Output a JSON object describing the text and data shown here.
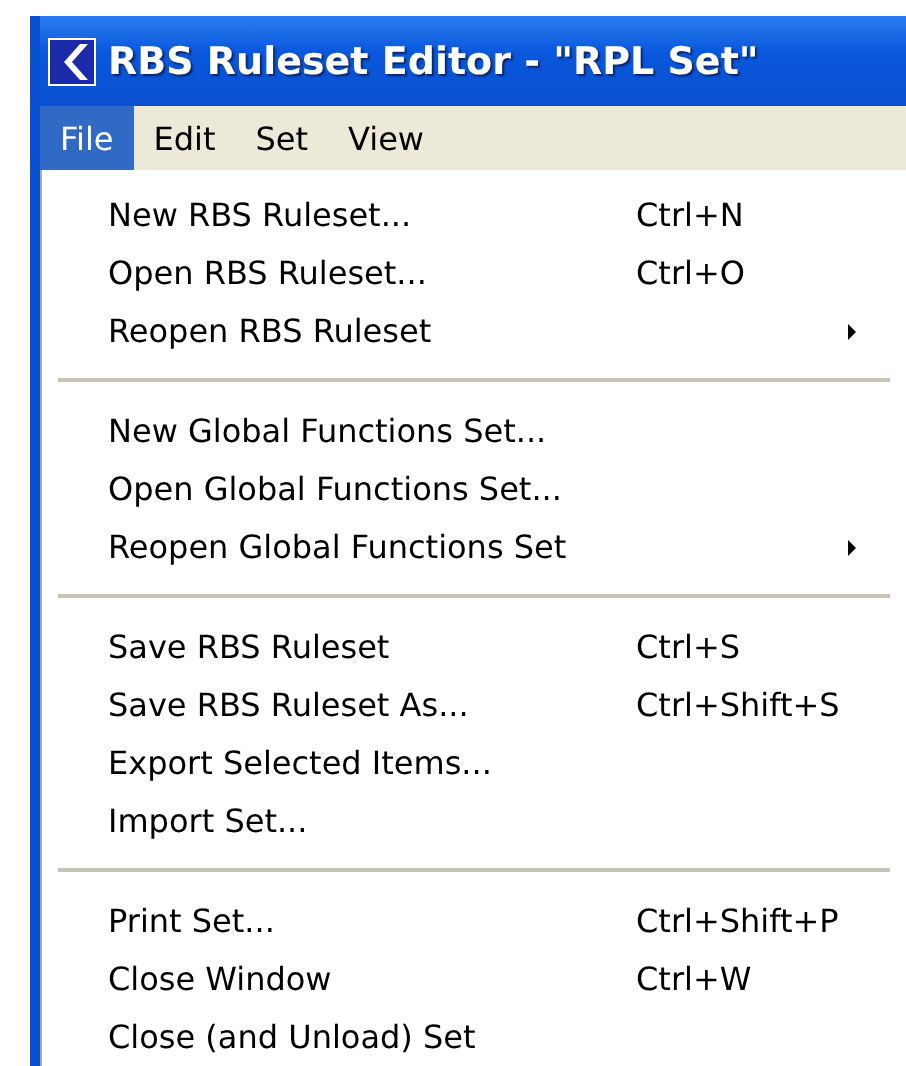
{
  "window": {
    "title": "RBS Ruleset Editor - \"RPL Set\""
  },
  "menu_bar": [
    {
      "label": "File",
      "selected": true
    },
    {
      "label": "Edit",
      "selected": false
    },
    {
      "label": "Set",
      "selected": false
    },
    {
      "label": "View",
      "selected": false
    }
  ],
  "menu": {
    "groups": [
      [
        {
          "label": "New RBS Ruleset...",
          "shortcut": "Ctrl+N",
          "kind": "command"
        },
        {
          "label": "Open RBS Ruleset...",
          "shortcut": "Ctrl+O",
          "kind": "command"
        },
        {
          "label": "Reopen RBS Ruleset",
          "kind": "submenu"
        }
      ],
      [
        {
          "label": "New Global Functions Set...",
          "kind": "command"
        },
        {
          "label": "Open Global Functions Set...",
          "kind": "command"
        },
        {
          "label": "Reopen Global Functions Set",
          "kind": "submenu"
        }
      ],
      [
        {
          "label": "Save RBS Ruleset",
          "shortcut": "Ctrl+S",
          "kind": "command"
        },
        {
          "label": "Save RBS Ruleset As...",
          "shortcut": "Ctrl+Shift+S",
          "kind": "command"
        },
        {
          "label": "Export Selected Items...",
          "kind": "command"
        },
        {
          "label": "Import Set...",
          "kind": "command"
        }
      ],
      [
        {
          "label": "Print Set...",
          "shortcut": "Ctrl+Shift+P",
          "kind": "command"
        },
        {
          "label": "Close Window",
          "shortcut": "Ctrl+W",
          "kind": "command"
        },
        {
          "label": "Close (and Unload) Set",
          "kind": "command"
        }
      ]
    ]
  }
}
